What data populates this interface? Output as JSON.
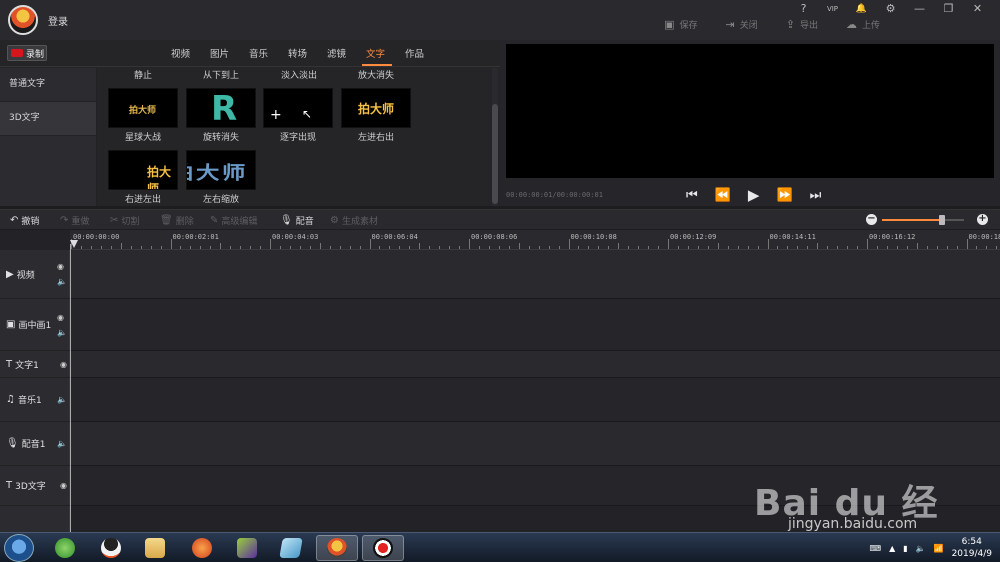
{
  "titlebar": {
    "login": "登录",
    "actions": [
      {
        "icon": "save-icon",
        "label": "保存"
      },
      {
        "icon": "close-icon",
        "label": "关闭"
      },
      {
        "icon": "export-icon",
        "label": "导出"
      },
      {
        "icon": "upload-icon",
        "label": "上传"
      }
    ],
    "window_controls": [
      "?",
      "VIP",
      "🔔",
      "⚙",
      "—",
      "❐",
      "✕"
    ]
  },
  "media": {
    "record_label": "录制",
    "tabs": [
      "视频",
      "图片",
      "音乐",
      "转场",
      "滤镜",
      "文字",
      "作品"
    ],
    "active_tab": "文字",
    "side_items": [
      "普通文字",
      "3D文字"
    ],
    "active_side": "3D文字",
    "top_row_labels": [
      "静止",
      "从下到上",
      "淡入淡出",
      "放大消失"
    ],
    "effects": [
      {
        "label": "星球大战",
        "preview": "拍大师"
      },
      {
        "label": "旋转消失",
        "preview": "R"
      },
      {
        "label": "逐字出现",
        "preview": "+"
      },
      {
        "label": "左进右出",
        "preview": "拍大师"
      },
      {
        "label": "右进左出",
        "preview": "拍大师"
      },
      {
        "label": "左右缩放",
        "preview": "拍大师"
      }
    ]
  },
  "preview": {
    "timecode": "00:00:00:01/00:00:00:01",
    "controls": [
      "⏮",
      "⏪",
      "▶",
      "⏩",
      "⏭"
    ]
  },
  "toolbar": {
    "items": [
      {
        "label": "撤销",
        "icon": "undo-icon",
        "enabled": true
      },
      {
        "label": "重做",
        "icon": "redo-icon",
        "enabled": false
      },
      {
        "label": "切割",
        "icon": "scissors-icon",
        "enabled": false
      },
      {
        "label": "删除",
        "icon": "trash-icon",
        "enabled": false
      },
      {
        "label": "高级编辑",
        "icon": "pencil-icon",
        "enabled": false
      },
      {
        "label": "配音",
        "icon": "microphone-icon",
        "enabled": true
      },
      {
        "label": "生成素材",
        "icon": "gear-icon",
        "enabled": false
      }
    ],
    "zoom_level": 0.73
  },
  "timeline": {
    "ruler_labels": [
      "00:00:00:00",
      "00:00:02:01",
      "00:00:04:03",
      "00:00:06:04",
      "00:00:08:06",
      "00:00:10:08",
      "00:00:12:09",
      "00:00:14:11",
      "00:00:16:12",
      "00:00:18:"
    ],
    "tracks": [
      {
        "name": "视频",
        "icon": "video-icon",
        "eye": true,
        "sound": true
      },
      {
        "name": "画中画1",
        "icon": "pip-icon",
        "eye": true,
        "sound": true
      },
      {
        "name": "文字1",
        "icon": "text-icon",
        "eye": true,
        "sound": false
      },
      {
        "name": "音乐1",
        "icon": "music-icon",
        "eye": false,
        "sound": true
      },
      {
        "name": "配音1",
        "icon": "microphone-icon",
        "eye": false,
        "sound": true
      },
      {
        "name": "3D文字",
        "icon": "text-icon",
        "eye": true,
        "sound": false
      }
    ]
  },
  "taskbar": {
    "time": "6:54",
    "date": "2019/4/9",
    "apps": [
      "360-browser",
      "qq",
      "file-explorer",
      "firefox",
      "media-player",
      "notebook",
      "pai-da-shi",
      "recorder"
    ]
  },
  "watermark": {
    "logo_text": "Bai du 经验",
    "url": "jingyan.baidu.com"
  }
}
